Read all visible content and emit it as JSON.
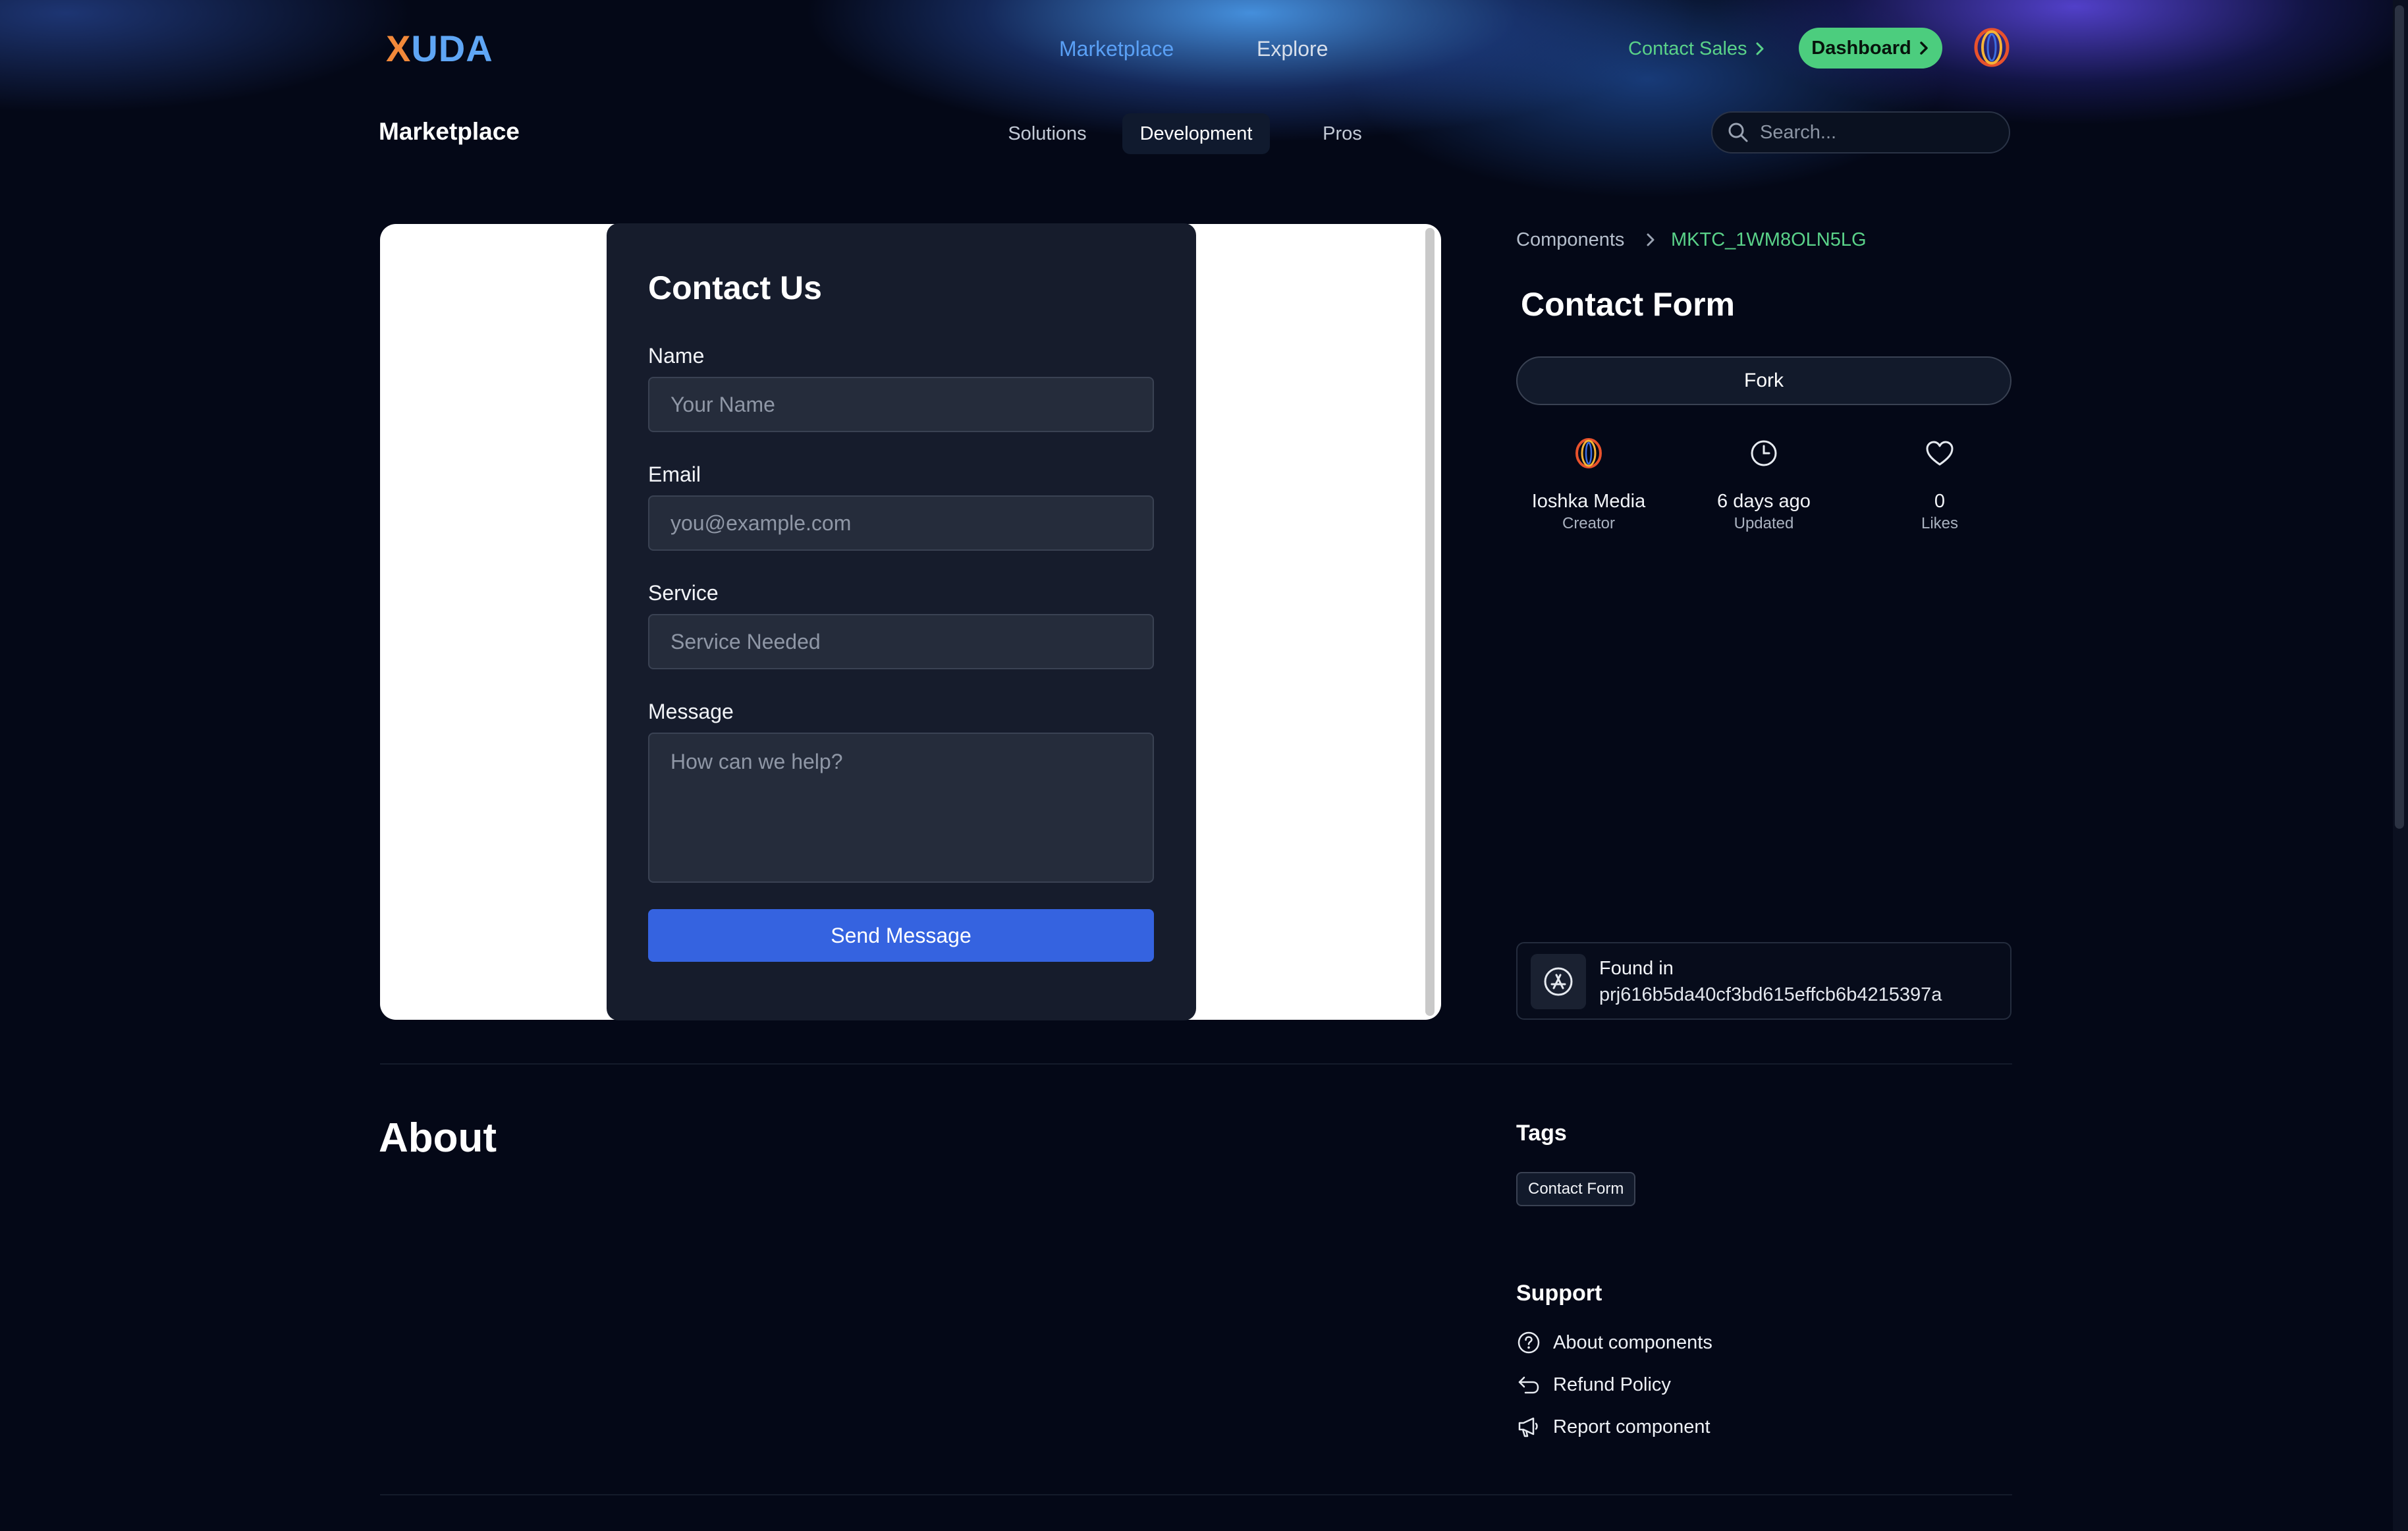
{
  "brand": {
    "logo_first": "X",
    "logo_rest": "UDA",
    "logo_color_x": "#f2893a",
    "logo_color_rest": "#5fa6f5"
  },
  "header": {
    "nav": {
      "marketplace": "Marketplace",
      "explore": "Explore"
    },
    "contact_sales": "Contact Sales",
    "dashboard": "Dashboard"
  },
  "subheader": {
    "title": "Marketplace",
    "tabs": {
      "solutions": "Solutions",
      "development": "Development",
      "pros": "Pros"
    },
    "active_tab": "Development",
    "search_placeholder": "Search..."
  },
  "preview": {
    "form_title": "Contact Us",
    "fields": {
      "name_label": "Name",
      "name_placeholder": "Your Name",
      "email_label": "Email",
      "email_placeholder": "you@example.com",
      "service_label": "Service",
      "service_placeholder": "Service Needed",
      "message_label": "Message",
      "message_placeholder": "How can we help?"
    },
    "submit": "Send Message",
    "accent": "#3563e0"
  },
  "detail": {
    "breadcrumb": {
      "root": "Components",
      "current": "MKTC_1WM8OLN5LG"
    },
    "title": "Contact Form",
    "fork": "Fork",
    "stats": {
      "creator_value": "Ioshka Media",
      "creator_label": "Creator",
      "updated_value": "6 days ago",
      "updated_label": "Updated",
      "likes_value": "0",
      "likes_label": "Likes"
    },
    "found_in": {
      "label": "Found in",
      "project": "prj616b5da40cf3bd615effcb6b4215397a"
    }
  },
  "about": {
    "title": "About"
  },
  "tags": {
    "title": "Tags",
    "items": [
      "Contact Form"
    ]
  },
  "support": {
    "title": "Support",
    "about_components": "About components",
    "refund_policy": "Refund Policy",
    "report_component": "Report component"
  },
  "colors": {
    "background": "#040817",
    "green": "#4ccd7e",
    "link_blue": "#5aa0f5"
  },
  "icons": [
    "search-icon",
    "chevron-right-icon",
    "creator-avatar-icon",
    "clock-icon",
    "heart-icon",
    "app-store-icon",
    "help-circle-icon",
    "return-icon",
    "megaphone-icon"
  ]
}
